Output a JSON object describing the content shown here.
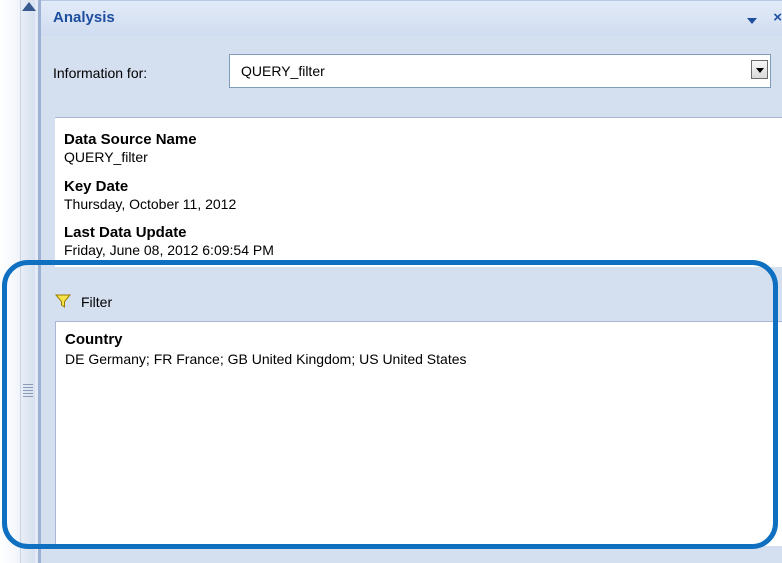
{
  "panel": {
    "title": "Analysis",
    "close_glyph": "×"
  },
  "info_for": {
    "label": "Information for:",
    "selected": "QUERY_filter"
  },
  "info": [
    {
      "key": "Data Source Name",
      "value": "QUERY_filter"
    },
    {
      "key": "Key Date",
      "value": "Thursday, October 11, 2012"
    },
    {
      "key": "Last Data Update",
      "value": "Friday, June 08, 2012 6:09:54 PM"
    }
  ],
  "filter": {
    "header": "Filter",
    "icon": "funnel-icon",
    "items": [
      {
        "key": "Country",
        "value": "DE Germany; FR France; GB United Kingdom; US United States"
      }
    ]
  },
  "colors": {
    "title": "#1e4ea0",
    "panel_bg": "#d4dff0",
    "highlight": "#0f6fc0"
  }
}
